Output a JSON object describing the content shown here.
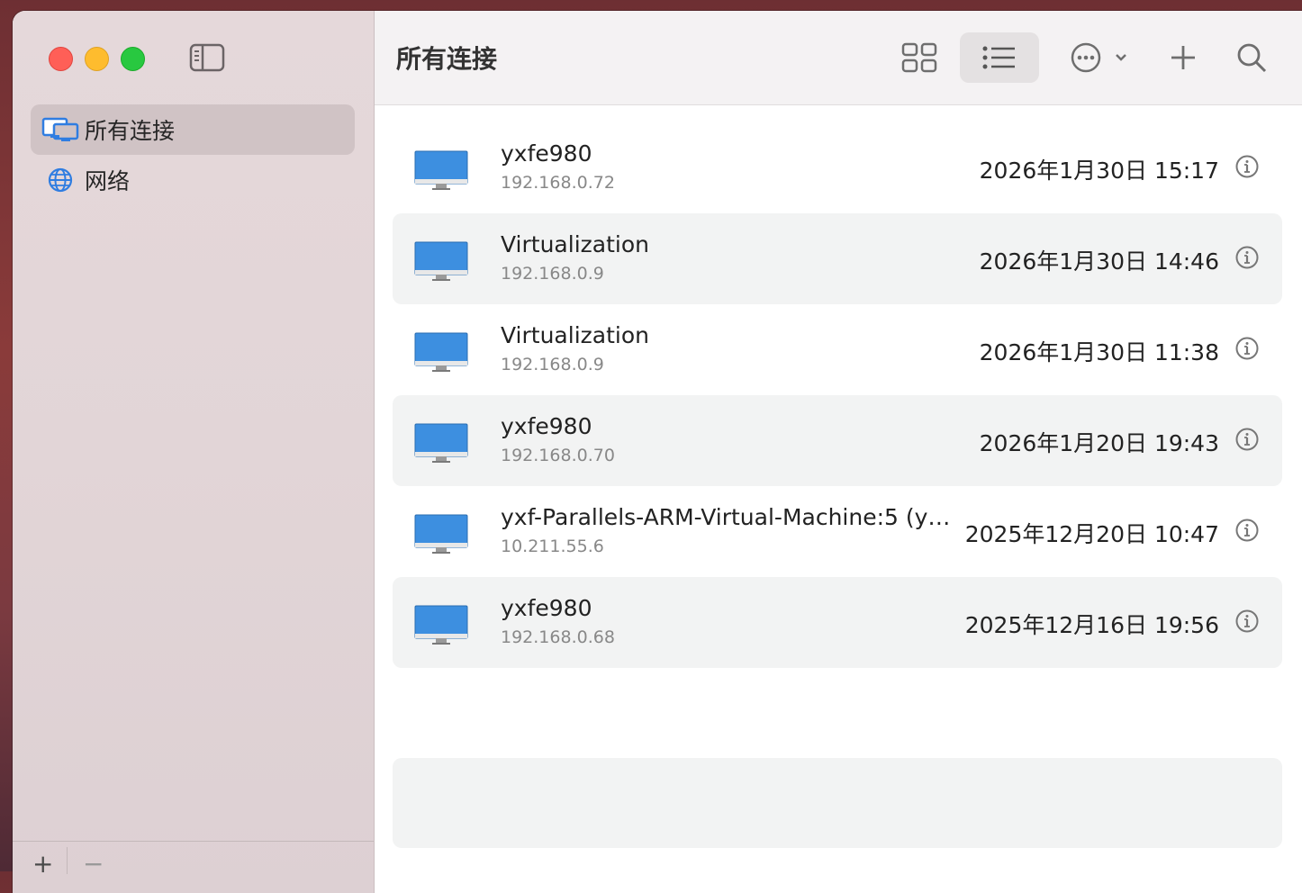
{
  "window": {
    "title": "所有连接"
  },
  "sidebar": {
    "items": [
      {
        "label": "所有连接",
        "icon": "displays-icon",
        "active": true
      },
      {
        "label": "网络",
        "icon": "globe-icon",
        "active": false
      }
    ],
    "add_label": "+",
    "remove_label": "−"
  },
  "toolbar": {
    "view_grid": "grid-view-icon",
    "view_list": "list-view-icon",
    "more": "ellipsis-circle-icon",
    "add": "plus-icon",
    "search": "search-icon"
  },
  "connections": [
    {
      "name": "yxfe980",
      "address": "192.168.0.72",
      "date": "2026年1月30日 15:17"
    },
    {
      "name": "Virtualization",
      "address": "192.168.0.9",
      "date": "2026年1月30日 14:46"
    },
    {
      "name": "Virtualization",
      "address": "192.168.0.9",
      "date": "2026年1月30日 11:38"
    },
    {
      "name": "yxfe980",
      "address": "192.168.0.70",
      "date": "2026年1月20日 19:43"
    },
    {
      "name": "yxf-Parallels-ARM-Virtual-Machine:5 (y…",
      "address": "10.211.55.6",
      "date": "2025年12月20日 10:47"
    },
    {
      "name": "yxfe980",
      "address": "192.168.0.68",
      "date": "2025年12月16日 19:56"
    }
  ],
  "colors": {
    "accent": "#2f7de1",
    "close": "#ff5f57",
    "minimize": "#febc2e",
    "maximize": "#28c840"
  }
}
